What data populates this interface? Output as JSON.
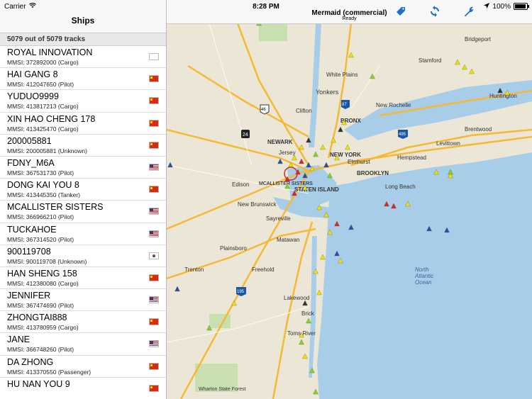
{
  "status": {
    "carrier": "Carrier",
    "time": "8:28 PM",
    "battery": "100%"
  },
  "sidebar": {
    "title": "Ships",
    "count_text": "5079 out of 5079 tracks",
    "items": [
      {
        "name": "ROYAL INNOVATION",
        "sub": "MMSI: 372892000 (Cargo)",
        "flag": "pa"
      },
      {
        "name": "HAI GANG 8",
        "sub": "MMSI: 412047650 (Pilot)",
        "flag": "cn"
      },
      {
        "name": "YUDUO9999",
        "sub": "MMSI: 413817213 (Cargo)",
        "flag": "cn"
      },
      {
        "name": "XIN HAO CHENG 178",
        "sub": "MMSI: 413425470 (Cargo)",
        "flag": "cn"
      },
      {
        "name": "200005881",
        "sub": "MMSI: 200005881 (Unknown)",
        "flag": "cn"
      },
      {
        "name": "FDNY_M6A",
        "sub": "MMSI: 367531730 (Pilot)",
        "flag": "us"
      },
      {
        "name": "DONG KAI YOU 8",
        "sub": "MMSI: 413445350 (Tanker)",
        "flag": "cn"
      },
      {
        "name": "MCALLISTER SISTERS",
        "sub": "MMSI: 366966210 (Pilot)",
        "flag": "us"
      },
      {
        "name": "TUCKAHOE",
        "sub": "MMSI: 367314520 (Pilot)",
        "flag": "us"
      },
      {
        "name": "900119708",
        "sub": "MMSI: 900119708 (Unknown)",
        "flag": "kr"
      },
      {
        "name": "HAN SHENG 158",
        "sub": "MMSI: 412380080 (Cargo)",
        "flag": "cn"
      },
      {
        "name": "JENNIFER",
        "sub": "MMSI: 367474690 (Pilot)",
        "flag": "us"
      },
      {
        "name": "ZHONGTAI888",
        "sub": "MMSI: 413780959 (Cargo)",
        "flag": "cn"
      },
      {
        "name": "JANE",
        "sub": "MMSI: 366748260 (Pilot)",
        "flag": "us"
      },
      {
        "name": "DA ZHONG",
        "sub": "MMSI: 413370550 (Passenger)",
        "flag": "cn"
      },
      {
        "name": "HU NAN YOU 9",
        "sub": "",
        "flag": "cn"
      }
    ]
  },
  "toolbar": {
    "title": "Mermaid (commercial)",
    "subtitle": "Ready",
    "icons": [
      "tag-icon",
      "refresh-icon",
      "wrench-icon"
    ]
  },
  "map": {
    "labels": {
      "bridgeport": "Bridgeport",
      "stamford": "Stamford",
      "white_plains": "White Plains",
      "yonkers": "Yonkers",
      "new_rochelle": "New Rochelle",
      "clifton": "Clifton",
      "bronx": "BRONX",
      "newark": "NEWARK",
      "new_york": "NEW YORK",
      "elmhurst": "Elmhurst",
      "brooklyn": "BROOKLYN",
      "staten_island": "STATEN ISLAND",
      "jersey": "Jersey",
      "edison": "Edison",
      "new_brunswick": "New Brunswick",
      "sayreville": "Sayreville",
      "hempstead": "Hempstead",
      "brentwood": "Brentwood",
      "levittown": "Levittown",
      "long_beach": "Long Beach",
      "freehold": "Freehold",
      "trenton": "Trenton",
      "lakewood": "Lakewood",
      "north_atlantic": "North\nAtlantic\nOcean",
      "huntington": "Huntington",
      "tracked": "MCALLISTER SISTERS",
      "matawan": "Matawan",
      "toms_river": "Toms River",
      "brick": "Brick",
      "wharton": "Wharton State Forest",
      "plainsboro": "Plainsboro"
    }
  },
  "colors": {
    "water": "#a8cde8",
    "land": "#ece6d6",
    "highway": "#f5b934",
    "park": "#c8e0b0"
  }
}
